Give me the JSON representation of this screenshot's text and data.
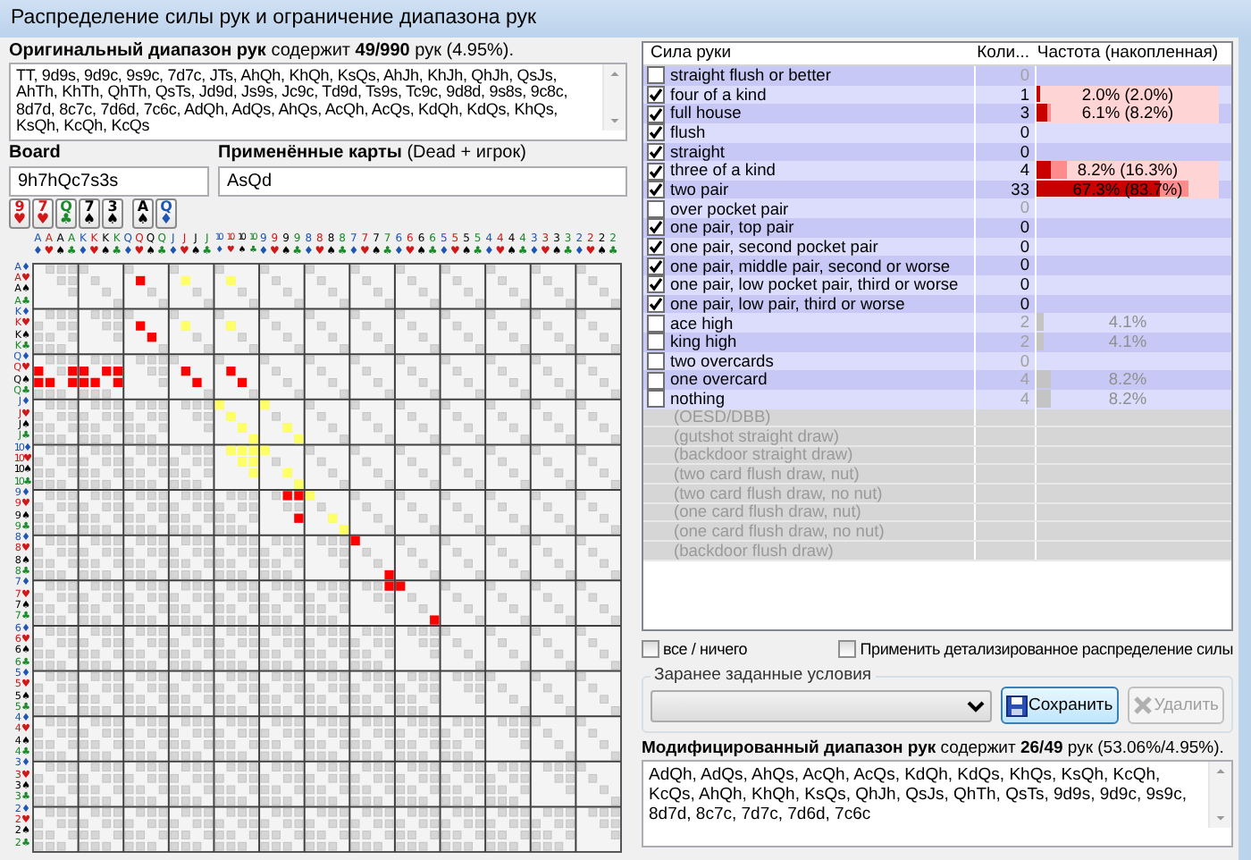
{
  "window": {
    "title": "Распределение силы рук и ограничение диапазона рук"
  },
  "original_range": {
    "summary": "**Оригинальный диапазон рук** содержит **49/990** рук (4.95%).",
    "hands": "TT, 9d9s, 9d9c, 9s9c, 7d7c, JTs, AhQh, KhQh, KsQs, AhJh, KhJh, QhJh, QsJs, AhTh, KhTh, QhTh, QsTs, Jd9d, Js9s, Jc9c, Td9d, Ts9s, Tc9c, 9d8d, 9s8s, 9c8c, 8d7d, 8c7c, 7d6d, 7c6c, AdQh, AdQs, AhQs, AcQh, AcQs, KdQh, KdQs, KhQs, KsQh, KcQh, KcQs"
  },
  "board": {
    "label": "Board",
    "value": "9h7hQc7s3s"
  },
  "dead": {
    "label": "**Применённые карты** (Dead + игрок)",
    "value": "AsQd"
  },
  "board_cards": [
    {
      "rank": "9",
      "suit": "♥",
      "color": "#d01818"
    },
    {
      "rank": "7",
      "suit": "♥",
      "color": "#d01818"
    },
    {
      "rank": "Q",
      "suit": "♣",
      "color": "#1a8a2a"
    },
    {
      "rank": "7",
      "suit": "♠",
      "color": "#000000"
    },
    {
      "rank": "3",
      "suit": "♠",
      "color": "#000000"
    }
  ],
  "dead_cards": [
    {
      "rank": "A",
      "suit": "♠",
      "color": "#000000"
    },
    {
      "rank": "Q",
      "suit": "♦",
      "color": "#1e56b4"
    }
  ],
  "matrix": {
    "columns": [
      {
        "rank": "A",
        "suit": "♦",
        "color": "#1e56b4"
      },
      {
        "rank": "A",
        "suit": "♥",
        "color": "#d01818"
      },
      {
        "rank": "A",
        "suit": "♠",
        "color": "#000000"
      },
      {
        "rank": "A",
        "suit": "♣",
        "color": "#1a8a2a"
      },
      {
        "rank": "K",
        "suit": "♦",
        "color": "#1e56b4"
      },
      {
        "rank": "K",
        "suit": "♥",
        "color": "#d01818"
      },
      {
        "rank": "K",
        "suit": "♠",
        "color": "#000000"
      },
      {
        "rank": "K",
        "suit": "♣",
        "color": "#1a8a2a"
      },
      {
        "rank": "Q",
        "suit": "♦",
        "color": "#1e56b4"
      },
      {
        "rank": "Q",
        "suit": "♥",
        "color": "#d01818"
      },
      {
        "rank": "Q",
        "suit": "♠",
        "color": "#000000"
      },
      {
        "rank": "Q",
        "suit": "♣",
        "color": "#1a8a2a"
      },
      {
        "rank": "J",
        "suit": "♦",
        "color": "#1e56b4"
      },
      {
        "rank": "J",
        "suit": "♥",
        "color": "#d01818"
      },
      {
        "rank": "J",
        "suit": "♠",
        "color": "#000000"
      },
      {
        "rank": "J",
        "suit": "♣",
        "color": "#1a8a2a"
      },
      {
        "rank": "10",
        "suit": "♦",
        "color": "#1e56b4"
      },
      {
        "rank": "10",
        "suit": "♥",
        "color": "#d01818"
      },
      {
        "rank": "10",
        "suit": "♠",
        "color": "#000000"
      },
      {
        "rank": "10",
        "suit": "♣",
        "color": "#1a8a2a"
      },
      {
        "rank": "9",
        "suit": "♦",
        "color": "#1e56b4"
      },
      {
        "rank": "9",
        "suit": "♥",
        "color": "#d01818"
      },
      {
        "rank": "9",
        "suit": "♠",
        "color": "#000000"
      },
      {
        "rank": "9",
        "suit": "♣",
        "color": "#1a8a2a"
      },
      {
        "rank": "8",
        "suit": "♦",
        "color": "#1e56b4"
      },
      {
        "rank": "8",
        "suit": "♥",
        "color": "#d01818"
      },
      {
        "rank": "8",
        "suit": "♠",
        "color": "#000000"
      },
      {
        "rank": "8",
        "suit": "♣",
        "color": "#1a8a2a"
      },
      {
        "rank": "7",
        "suit": "♦",
        "color": "#1e56b4"
      },
      {
        "rank": "7",
        "suit": "♥",
        "color": "#d01818"
      },
      {
        "rank": "7",
        "suit": "♠",
        "color": "#000000"
      },
      {
        "rank": "7",
        "suit": "♣",
        "color": "#1a8a2a"
      },
      {
        "rank": "6",
        "suit": "♦",
        "color": "#1e56b4"
      },
      {
        "rank": "6",
        "suit": "♥",
        "color": "#d01818"
      },
      {
        "rank": "6",
        "suit": "♠",
        "color": "#000000"
      },
      {
        "rank": "6",
        "suit": "♣",
        "color": "#1a8a2a"
      },
      {
        "rank": "5",
        "suit": "♦",
        "color": "#1e56b4"
      },
      {
        "rank": "5",
        "suit": "♥",
        "color": "#d01818"
      },
      {
        "rank": "5",
        "suit": "♠",
        "color": "#000000"
      },
      {
        "rank": "5",
        "suit": "♣",
        "color": "#1a8a2a"
      },
      {
        "rank": "4",
        "suit": "♦",
        "color": "#1e56b4"
      },
      {
        "rank": "4",
        "suit": "♥",
        "color": "#d01818"
      },
      {
        "rank": "4",
        "suit": "♠",
        "color": "#000000"
      },
      {
        "rank": "4",
        "suit": "♣",
        "color": "#1a8a2a"
      },
      {
        "rank": "3",
        "suit": "♦",
        "color": "#1e56b4"
      },
      {
        "rank": "3",
        "suit": "♥",
        "color": "#d01818"
      },
      {
        "rank": "3",
        "suit": "♠",
        "color": "#000000"
      },
      {
        "rank": "3",
        "suit": "♣",
        "color": "#1a8a2a"
      },
      {
        "rank": "2",
        "suit": "♦",
        "color": "#1e56b4"
      },
      {
        "rank": "2",
        "suit": "♥",
        "color": "#d01818"
      },
      {
        "rank": "2",
        "suit": "♠",
        "color": "#000000"
      },
      {
        "rank": "2",
        "suit": "♣",
        "color": "#1a8a2a"
      }
    ],
    "rows": [
      {
        "rank": "A",
        "suit": "♦",
        "color": "#1e56b4"
      },
      {
        "rank": "A",
        "suit": "♥",
        "color": "#d01818",
        "cells": [
          null,
          null,
          null,
          null,
          null,
          null,
          null,
          null,
          null,
          {
            "color": "#ff0000"
          },
          null,
          null,
          null,
          {
            "color": "#ffff66"
          },
          null,
          null,
          null,
          {
            "color": "#ffff66"
          }
        ]
      },
      {
        "rank": "A",
        "suit": "♠",
        "color": "#000000"
      },
      {
        "rank": "A",
        "suit": "♣",
        "color": "#1a8a2a"
      },
      {
        "rank": "K",
        "suit": "♦",
        "color": "#1e56b4"
      },
      {
        "rank": "K",
        "suit": "♥",
        "color": "#d01818",
        "cells": [
          null,
          null,
          null,
          null,
          null,
          null,
          null,
          null,
          null,
          {
            "color": "#ff0000"
          },
          null,
          null,
          null,
          {
            "color": "#ffff66"
          },
          null,
          null,
          null,
          {
            "color": "#ffff66"
          }
        ]
      },
      {
        "rank": "K",
        "suit": "♠",
        "color": "#000000",
        "cells": [
          null,
          null,
          null,
          null,
          null,
          null,
          null,
          null,
          null,
          null,
          {
            "color": "#ff0000"
          }
        ]
      },
      {
        "rank": "K",
        "suit": "♣",
        "color": "#1a8a2a"
      },
      {
        "rank": "Q",
        "suit": "♦",
        "color": "#1e56b4"
      },
      {
        "rank": "Q",
        "suit": "♥",
        "color": "#d01818",
        "cells": [
          {
            "color": "#ff0000"
          },
          null,
          null,
          {
            "color": "#ff0000"
          },
          {
            "color": "#ff0000"
          },
          null,
          {
            "color": "#ff0000"
          },
          {
            "color": "#ff0000"
          },
          null,
          null,
          null,
          null,
          null,
          {
            "color": "#ff0000"
          },
          null,
          null,
          null,
          {
            "color": "#ff0000"
          }
        ]
      },
      {
        "rank": "Q",
        "suit": "♠",
        "color": "#000000",
        "cells": [
          {
            "color": "#ff0000"
          },
          {
            "color": "#ff0000"
          },
          null,
          {
            "color": "#ff0000"
          },
          {
            "color": "#ff0000"
          },
          {
            "color": "#ff0000"
          },
          null,
          {
            "color": "#ff0000"
          },
          null,
          null,
          null,
          null,
          null,
          null,
          {
            "color": "#ff0000"
          },
          null,
          null,
          null,
          {
            "color": "#ff0000"
          }
        ]
      },
      {
        "rank": "Q",
        "suit": "♣",
        "color": "#1a8a2a"
      },
      {
        "rank": "J",
        "suit": "♦",
        "color": "#1e56b4",
        "cells": [
          null,
          null,
          null,
          null,
          null,
          null,
          null,
          null,
          null,
          null,
          null,
          null,
          null,
          null,
          null,
          null,
          {
            "color": "#ffff66"
          },
          null,
          null,
          null,
          {
            "color": "#ffff66"
          }
        ]
      },
      {
        "rank": "J",
        "suit": "♥",
        "color": "#d01818",
        "cells": [
          null,
          null,
          null,
          null,
          null,
          null,
          null,
          null,
          null,
          null,
          null,
          null,
          null,
          null,
          null,
          null,
          null,
          {
            "color": "#ffff66"
          }
        ]
      },
      {
        "rank": "J",
        "suit": "♠",
        "color": "#000000",
        "cells": [
          null,
          null,
          null,
          null,
          null,
          null,
          null,
          null,
          null,
          null,
          null,
          null,
          null,
          null,
          null,
          null,
          null,
          null,
          {
            "color": "#ffff66"
          },
          null,
          null,
          null,
          {
            "color": "#ffff66"
          }
        ]
      },
      {
        "rank": "J",
        "suit": "♣",
        "color": "#1a8a2a",
        "cells": [
          null,
          null,
          null,
          null,
          null,
          null,
          null,
          null,
          null,
          null,
          null,
          null,
          null,
          null,
          null,
          null,
          null,
          null,
          null,
          {
            "color": "#ffff66"
          },
          null,
          null,
          null,
          {
            "color": "#ffff66"
          }
        ]
      },
      {
        "rank": "10",
        "suit": "♦",
        "color": "#1e56b4",
        "cells": [
          null,
          null,
          null,
          null,
          null,
          null,
          null,
          null,
          null,
          null,
          null,
          null,
          null,
          null,
          null,
          null,
          null,
          {
            "color": "#ffff66"
          },
          {
            "color": "#ffff66"
          },
          {
            "color": "#ffff66"
          },
          {
            "color": "#ffff66"
          }
        ]
      },
      {
        "rank": "10",
        "suit": "♥",
        "color": "#d01818",
        "cells": [
          null,
          null,
          null,
          null,
          null,
          null,
          null,
          null,
          null,
          null,
          null,
          null,
          null,
          null,
          null,
          null,
          null,
          null,
          {
            "color": "#ffff66"
          },
          {
            "color": "#ffff66"
          }
        ]
      },
      {
        "rank": "10",
        "suit": "♠",
        "color": "#000000",
        "cells": [
          null,
          null,
          null,
          null,
          null,
          null,
          null,
          null,
          null,
          null,
          null,
          null,
          null,
          null,
          null,
          null,
          null,
          null,
          null,
          {
            "color": "#ffff66"
          },
          null,
          null,
          {
            "color": "#ffff66"
          }
        ]
      },
      {
        "rank": "10",
        "suit": "♣",
        "color": "#1a8a2a",
        "cells": [
          null,
          null,
          null,
          null,
          null,
          null,
          null,
          null,
          null,
          null,
          null,
          null,
          null,
          null,
          null,
          null,
          null,
          null,
          null,
          null,
          null,
          null,
          null,
          {
            "color": "#ffff66"
          }
        ]
      },
      {
        "rank": "9",
        "suit": "♦",
        "color": "#1e56b4",
        "cells": [
          null,
          null,
          null,
          null,
          null,
          null,
          null,
          null,
          null,
          null,
          null,
          null,
          null,
          null,
          null,
          null,
          null,
          null,
          null,
          null,
          null,
          null,
          {
            "color": "#ff0000"
          },
          {
            "color": "#ff0000"
          },
          {
            "color": "#ffff66"
          }
        ]
      },
      {
        "rank": "9",
        "suit": "♥",
        "color": "#d01818"
      },
      {
        "rank": "9",
        "suit": "♠",
        "color": "#000000",
        "cells": [
          null,
          null,
          null,
          null,
          null,
          null,
          null,
          null,
          null,
          null,
          null,
          null,
          null,
          null,
          null,
          null,
          null,
          null,
          null,
          null,
          null,
          null,
          null,
          {
            "color": "#ff0000"
          },
          null,
          null,
          {
            "color": "#ffff66"
          }
        ]
      },
      {
        "rank": "9",
        "suit": "♣",
        "color": "#1a8a2a",
        "cells": [
          null,
          null,
          null,
          null,
          null,
          null,
          null,
          null,
          null,
          null,
          null,
          null,
          null,
          null,
          null,
          null,
          null,
          null,
          null,
          null,
          null,
          null,
          null,
          null,
          null,
          null,
          null,
          {
            "color": "#ffff66"
          }
        ]
      },
      {
        "rank": "8",
        "suit": "♦",
        "color": "#1e56b4",
        "cells": [
          null,
          null,
          null,
          null,
          null,
          null,
          null,
          null,
          null,
          null,
          null,
          null,
          null,
          null,
          null,
          null,
          null,
          null,
          null,
          null,
          null,
          null,
          null,
          null,
          null,
          null,
          null,
          null,
          {
            "color": "#ff0000"
          }
        ]
      },
      {
        "rank": "8",
        "suit": "♥",
        "color": "#d01818"
      },
      {
        "rank": "8",
        "suit": "♠",
        "color": "#000000"
      },
      {
        "rank": "8",
        "suit": "♣",
        "color": "#1a8a2a",
        "cells": [
          null,
          null,
          null,
          null,
          null,
          null,
          null,
          null,
          null,
          null,
          null,
          null,
          null,
          null,
          null,
          null,
          null,
          null,
          null,
          null,
          null,
          null,
          null,
          null,
          null,
          null,
          null,
          null,
          null,
          null,
          null,
          {
            "color": "#ff0000"
          }
        ]
      },
      {
        "rank": "7",
        "suit": "♦",
        "color": "#1e56b4",
        "cells": [
          null,
          null,
          null,
          null,
          null,
          null,
          null,
          null,
          null,
          null,
          null,
          null,
          null,
          null,
          null,
          null,
          null,
          null,
          null,
          null,
          null,
          null,
          null,
          null,
          null,
          null,
          null,
          null,
          null,
          null,
          null,
          {
            "color": "#ff0000"
          },
          {
            "color": "#ff0000"
          }
        ]
      },
      {
        "rank": "7",
        "suit": "♥",
        "color": "#d01818"
      },
      {
        "rank": "7",
        "suit": "♠",
        "color": "#000000"
      },
      {
        "rank": "7",
        "suit": "♣",
        "color": "#1a8a2a",
        "cells": [
          null,
          null,
          null,
          null,
          null,
          null,
          null,
          null,
          null,
          null,
          null,
          null,
          null,
          null,
          null,
          null,
          null,
          null,
          null,
          null,
          null,
          null,
          null,
          null,
          null,
          null,
          null,
          null,
          null,
          null,
          null,
          null,
          null,
          null,
          null,
          {
            "color": "#ff0000"
          }
        ]
      },
      {
        "rank": "6",
        "suit": "♦",
        "color": "#1e56b4"
      },
      {
        "rank": "6",
        "suit": "♥",
        "color": "#d01818"
      },
      {
        "rank": "6",
        "suit": "♠",
        "color": "#000000"
      },
      {
        "rank": "6",
        "suit": "♣",
        "color": "#1a8a2a"
      },
      {
        "rank": "5",
        "suit": "♦",
        "color": "#1e56b4"
      },
      {
        "rank": "5",
        "suit": "♥",
        "color": "#d01818"
      },
      {
        "rank": "5",
        "suit": "♠",
        "color": "#000000"
      },
      {
        "rank": "5",
        "suit": "♣",
        "color": "#1a8a2a"
      },
      {
        "rank": "4",
        "suit": "♦",
        "color": "#1e56b4"
      },
      {
        "rank": "4",
        "suit": "♥",
        "color": "#d01818"
      },
      {
        "rank": "4",
        "suit": "♠",
        "color": "#000000"
      },
      {
        "rank": "4",
        "suit": "♣",
        "color": "#1a8a2a"
      },
      {
        "rank": "3",
        "suit": "♦",
        "color": "#1e56b4"
      },
      {
        "rank": "3",
        "suit": "♥",
        "color": "#d01818"
      },
      {
        "rank": "3",
        "suit": "♠",
        "color": "#000000"
      },
      {
        "rank": "3",
        "suit": "♣",
        "color": "#1a8a2a"
      },
      {
        "rank": "2",
        "suit": "♦",
        "color": "#1e56b4"
      },
      {
        "rank": "2",
        "suit": "♥",
        "color": "#d01818"
      },
      {
        "rank": "2",
        "suit": "♠",
        "color": "#000000"
      },
      {
        "rank": "2",
        "suit": "♣",
        "color": "#1a8a2a"
      }
    ]
  },
  "strength_table": {
    "columns": [
      "Сила руки",
      "Коли...",
      "Частота (накопленная)"
    ],
    "rows": [
      {
        "kind": "category",
        "label": "straight flush or better",
        "checked": false,
        "count": "0"
      },
      {
        "kind": "category",
        "label": "four of a kind",
        "checked": true,
        "count": "1",
        "frequency": "2.0% (2.0%)",
        "level": 0.02,
        "cumulative": {
          "level": 0.02
        }
      },
      {
        "kind": "category",
        "label": "full house",
        "checked": true,
        "count": "3",
        "frequency": "6.1% (8.2%)",
        "level": 0.061,
        "cumulative": {
          "level": 0.082
        }
      },
      {
        "kind": "category",
        "label": "flush",
        "checked": true,
        "count": "0"
      },
      {
        "kind": "category",
        "label": "straight",
        "checked": true,
        "count": "0"
      },
      {
        "kind": "category",
        "label": "three of a kind",
        "checked": true,
        "count": "4",
        "frequency": "8.2% (16.3%)",
        "level": 0.082,
        "cumulative": {
          "level": 0.163
        }
      },
      {
        "kind": "category",
        "label": "two pair",
        "checked": true,
        "count": "33",
        "frequency": "67.3% (83.7%)",
        "level": 0.673,
        "cumulative": {
          "level": 0.837
        }
      },
      {
        "kind": "category",
        "label": "over pocket pair",
        "checked": false,
        "count": "0"
      },
      {
        "kind": "category",
        "label": "one pair, top pair",
        "checked": true,
        "count": "0"
      },
      {
        "kind": "category",
        "label": "one pair, second pocket pair",
        "checked": true,
        "count": "0"
      },
      {
        "kind": "category",
        "label": "one pair, middle pair, second or worse",
        "checked": true,
        "count": "0"
      },
      {
        "kind": "category",
        "label": "one pair, low pocket pair, third or worse",
        "checked": true,
        "count": "0"
      },
      {
        "kind": "category",
        "label": "one pair, low pair, third or worse",
        "checked": true,
        "count": "0"
      },
      {
        "kind": "category",
        "label": "ace high",
        "checked": false,
        "count": "2",
        "frequency": "4.1%",
        "level": 0.041
      },
      {
        "kind": "category",
        "label": "king high",
        "checked": false,
        "count": "2",
        "frequency": "4.1%",
        "level": 0.041
      },
      {
        "kind": "category",
        "label": "two overcards",
        "checked": false,
        "count": "0"
      },
      {
        "kind": "category",
        "label": "one overcard",
        "checked": false,
        "count": "4",
        "frequency": "8.2%",
        "level": 0.082
      },
      {
        "kind": "category",
        "label": "nothing",
        "checked": false,
        "count": "4",
        "frequency": "8.2%",
        "level": 0.082
      },
      {
        "kind": "draw",
        "label": "(OESD/DBB)"
      },
      {
        "kind": "draw",
        "label": "(gutshot straight draw)"
      },
      {
        "kind": "draw",
        "label": "(backdoor straight draw)"
      },
      {
        "kind": "draw",
        "label": "(two card flush draw, nut)"
      },
      {
        "kind": "draw",
        "label": "(two card flush draw, no nut)"
      },
      {
        "kind": "draw",
        "label": "(one card flush draw, nut)"
      },
      {
        "kind": "draw",
        "label": "(one card flush draw, no nut)"
      },
      {
        "kind": "draw",
        "label": "(backdoor flush draw)"
      }
    ]
  },
  "options": [
    {
      "label": "все / ничего",
      "checked": false
    },
    {
      "label": "Применить детализированное распределение силы",
      "checked": false
    }
  ],
  "presets": {
    "title": "Заранее заданные условия",
    "buttons": [
      {
        "kind": "save",
        "label": "Сохранить",
        "disabled": false
      },
      {
        "kind": "delete",
        "label": "Удалить",
        "disabled": true
      }
    ]
  },
  "modified_range": {
    "summary": "**Модифицированный диапазон рук** содержит **26/49** рук (53.06%/4.95%).",
    "hands": "AdQh, AdQs, AhQs, AcQh, AcQs, KdQh, KdQs, KhQs, KsQh, KcQh, KcQs, AhQh, KhQh, KsQs, QhJh, QsJs, QhTh, QsTs, 9d9s, 9d9c, 9s9c, 8d7d, 8c7c, 7d7c, 7d6d, 7c6c"
  }
}
